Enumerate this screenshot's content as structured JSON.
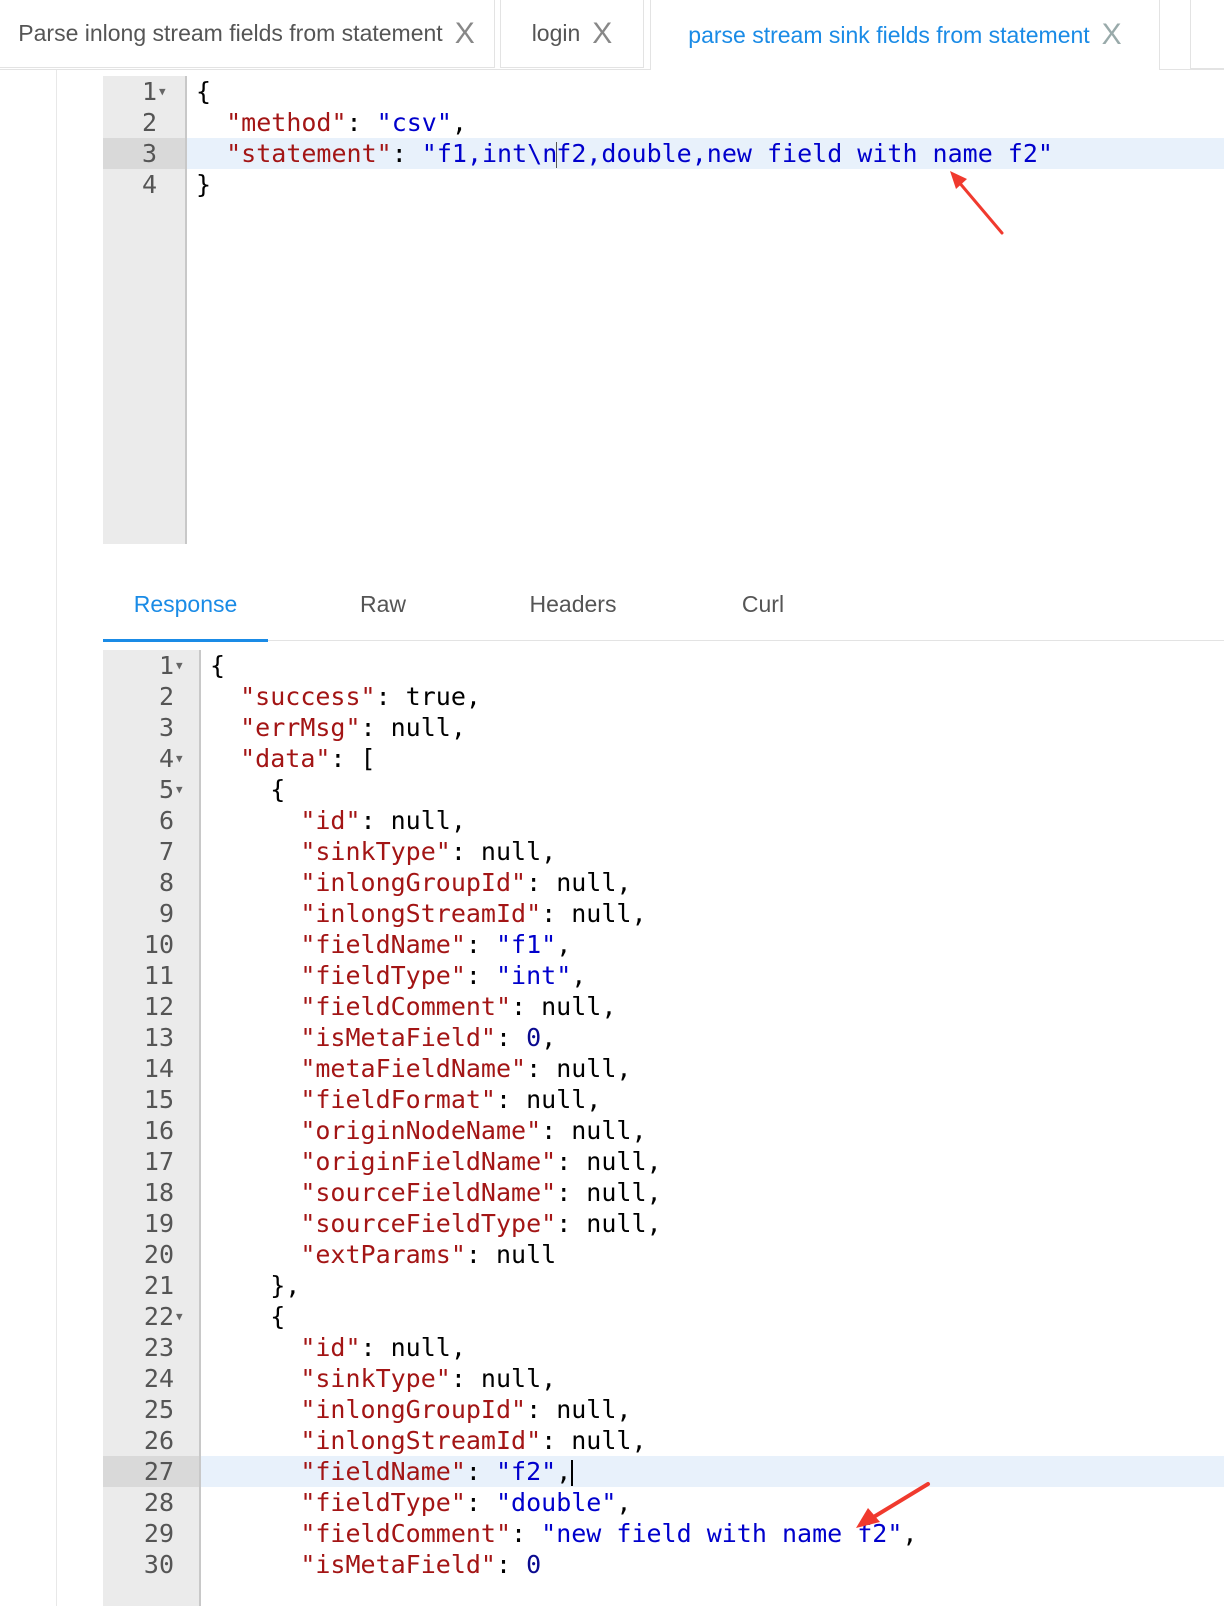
{
  "tabs": [
    {
      "label": "Parse inlong stream fields from statement",
      "close": "X",
      "active": false
    },
    {
      "label": "login",
      "close": "X",
      "active": false
    },
    {
      "label": "parse stream sink fields from statement",
      "close": "X",
      "active": true
    }
  ],
  "request_editor": {
    "line_numbers": [
      "1",
      "2",
      "3",
      "4"
    ],
    "lines": [
      [
        {
          "t": "{",
          "c": "p"
        }
      ],
      [
        {
          "t": "  ",
          "c": "p"
        },
        {
          "t": "\"method\"",
          "c": "k"
        },
        {
          "t": ": ",
          "c": "p"
        },
        {
          "t": "\"csv\"",
          "c": "s"
        },
        {
          "t": ",",
          "c": "p"
        }
      ],
      [
        {
          "t": "  ",
          "c": "p"
        },
        {
          "t": "\"statement\"",
          "c": "k"
        },
        {
          "t": ": ",
          "c": "p"
        },
        {
          "t": "\"f1,int\\n",
          "c": "s"
        },
        {
          "t": "f2,double,new field with name f2\"",
          "c": "s"
        }
      ],
      [
        {
          "t": "}",
          "c": "p"
        }
      ]
    ]
  },
  "response_tabs": [
    "Response",
    "Raw",
    "Headers",
    "Curl"
  ],
  "response_editor": {
    "line_numbers": [
      "1",
      "2",
      "3",
      "4",
      "5",
      "6",
      "7",
      "8",
      "9",
      "10",
      "11",
      "12",
      "13",
      "14",
      "15",
      "16",
      "17",
      "18",
      "19",
      "20",
      "21",
      "22",
      "23",
      "24",
      "25",
      "26",
      "27",
      "28",
      "29",
      "30"
    ],
    "lines": [
      [
        {
          "t": "{",
          "c": "p"
        }
      ],
      [
        {
          "t": "  ",
          "c": "p"
        },
        {
          "t": "\"success\"",
          "c": "k"
        },
        {
          "t": ": true,",
          "c": "p"
        }
      ],
      [
        {
          "t": "  ",
          "c": "p"
        },
        {
          "t": "\"errMsg\"",
          "c": "k"
        },
        {
          "t": ": null,",
          "c": "p"
        }
      ],
      [
        {
          "t": "  ",
          "c": "p"
        },
        {
          "t": "\"data\"",
          "c": "k"
        },
        {
          "t": ": [",
          "c": "p"
        }
      ],
      [
        {
          "t": "    {",
          "c": "p"
        }
      ],
      [
        {
          "t": "      ",
          "c": "p"
        },
        {
          "t": "\"id\"",
          "c": "k"
        },
        {
          "t": ": null,",
          "c": "p"
        }
      ],
      [
        {
          "t": "      ",
          "c": "p"
        },
        {
          "t": "\"sinkType\"",
          "c": "k"
        },
        {
          "t": ": null,",
          "c": "p"
        }
      ],
      [
        {
          "t": "      ",
          "c": "p"
        },
        {
          "t": "\"inlongGroupId\"",
          "c": "k"
        },
        {
          "t": ": null,",
          "c": "p"
        }
      ],
      [
        {
          "t": "      ",
          "c": "p"
        },
        {
          "t": "\"inlongStreamId\"",
          "c": "k"
        },
        {
          "t": ": null,",
          "c": "p"
        }
      ],
      [
        {
          "t": "      ",
          "c": "p"
        },
        {
          "t": "\"fieldName\"",
          "c": "k"
        },
        {
          "t": ": ",
          "c": "p"
        },
        {
          "t": "\"f1\"",
          "c": "s"
        },
        {
          "t": ",",
          "c": "p"
        }
      ],
      [
        {
          "t": "      ",
          "c": "p"
        },
        {
          "t": "\"fieldType\"",
          "c": "k"
        },
        {
          "t": ": ",
          "c": "p"
        },
        {
          "t": "\"int\"",
          "c": "s"
        },
        {
          "t": ",",
          "c": "p"
        }
      ],
      [
        {
          "t": "      ",
          "c": "p"
        },
        {
          "t": "\"fieldComment\"",
          "c": "k"
        },
        {
          "t": ": null,",
          "c": "p"
        }
      ],
      [
        {
          "t": "      ",
          "c": "p"
        },
        {
          "t": "\"isMetaField\"",
          "c": "k"
        },
        {
          "t": ": ",
          "c": "p"
        },
        {
          "t": "0",
          "c": "n"
        },
        {
          "t": ",",
          "c": "p"
        }
      ],
      [
        {
          "t": "      ",
          "c": "p"
        },
        {
          "t": "\"metaFieldName\"",
          "c": "k"
        },
        {
          "t": ": null,",
          "c": "p"
        }
      ],
      [
        {
          "t": "      ",
          "c": "p"
        },
        {
          "t": "\"fieldFormat\"",
          "c": "k"
        },
        {
          "t": ": null,",
          "c": "p"
        }
      ],
      [
        {
          "t": "      ",
          "c": "p"
        },
        {
          "t": "\"originNodeName\"",
          "c": "k"
        },
        {
          "t": ": null,",
          "c": "p"
        }
      ],
      [
        {
          "t": "      ",
          "c": "p"
        },
        {
          "t": "\"originFieldName\"",
          "c": "k"
        },
        {
          "t": ": null,",
          "c": "p"
        }
      ],
      [
        {
          "t": "      ",
          "c": "p"
        },
        {
          "t": "\"sourceFieldName\"",
          "c": "k"
        },
        {
          "t": ": null,",
          "c": "p"
        }
      ],
      [
        {
          "t": "      ",
          "c": "p"
        },
        {
          "t": "\"sourceFieldType\"",
          "c": "k"
        },
        {
          "t": ": null,",
          "c": "p"
        }
      ],
      [
        {
          "t": "      ",
          "c": "p"
        },
        {
          "t": "\"extParams\"",
          "c": "k"
        },
        {
          "t": ": null",
          "c": "p"
        }
      ],
      [
        {
          "t": "    },",
          "c": "p"
        }
      ],
      [
        {
          "t": "    {",
          "c": "p"
        }
      ],
      [
        {
          "t": "      ",
          "c": "p"
        },
        {
          "t": "\"id\"",
          "c": "k"
        },
        {
          "t": ": null,",
          "c": "p"
        }
      ],
      [
        {
          "t": "      ",
          "c": "p"
        },
        {
          "t": "\"sinkType\"",
          "c": "k"
        },
        {
          "t": ": null,",
          "c": "p"
        }
      ],
      [
        {
          "t": "      ",
          "c": "p"
        },
        {
          "t": "\"inlongGroupId\"",
          "c": "k"
        },
        {
          "t": ": null,",
          "c": "p"
        }
      ],
      [
        {
          "t": "      ",
          "c": "p"
        },
        {
          "t": "\"inlongStreamId\"",
          "c": "k"
        },
        {
          "t": ": null,",
          "c": "p"
        }
      ],
      [
        {
          "t": "      ",
          "c": "p"
        },
        {
          "t": "\"fieldName\"",
          "c": "k"
        },
        {
          "t": ": ",
          "c": "p"
        },
        {
          "t": "\"f2\"",
          "c": "s"
        },
        {
          "t": ",",
          "c": "p"
        }
      ],
      [
        {
          "t": "      ",
          "c": "p"
        },
        {
          "t": "\"fieldType\"",
          "c": "k"
        },
        {
          "t": ": ",
          "c": "p"
        },
        {
          "t": "\"double\"",
          "c": "s"
        },
        {
          "t": ",",
          "c": "p"
        }
      ],
      [
        {
          "t": "      ",
          "c": "p"
        },
        {
          "t": "\"fieldComment\"",
          "c": "k"
        },
        {
          "t": ": ",
          "c": "p"
        },
        {
          "t": "\"new field with name f2\"",
          "c": "s"
        },
        {
          "t": ",",
          "c": "p"
        }
      ],
      [
        {
          "t": "      ",
          "c": "p"
        },
        {
          "t": "\"isMetaField\"",
          "c": "k"
        },
        {
          "t": ": ",
          "c": "p"
        },
        {
          "t": "0",
          "c": "n"
        }
      ]
    ]
  },
  "colors": {
    "accent": "#1a8be6",
    "annotation_arrow": "#f03a2e",
    "key": "#a31515",
    "string": "#0000cc"
  },
  "icons": [
    "close-icon",
    "fold-arrow-icon",
    "annotation-arrow"
  ]
}
